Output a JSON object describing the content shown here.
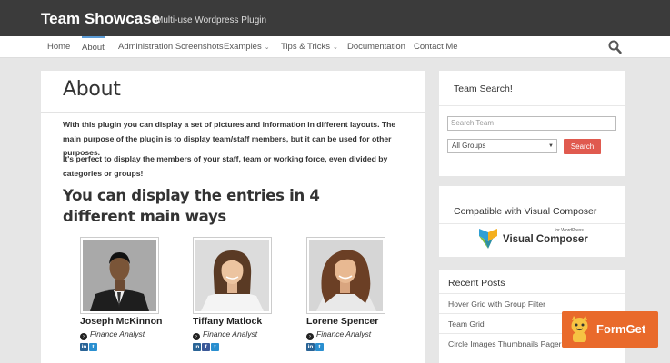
{
  "header": {
    "brand": "Team Showcase",
    "tagline": "Multi-use Wordpress Plugin"
  },
  "nav": {
    "items": [
      {
        "label": "Home"
      },
      {
        "label": "About",
        "active": true
      },
      {
        "label": "Administration Screenshots"
      },
      {
        "label": "Examples"
      },
      {
        "label": "Tips & Tricks"
      },
      {
        "label": "Documentation"
      },
      {
        "label": "Contact Me"
      }
    ],
    "caret": "⌄",
    "search_icon": "search-icon"
  },
  "main": {
    "title": "About",
    "paragraph1": "With this plugin you can display a set of pictures and information in different layouts. The main purpose of the plugin is to display team/staff members, but it can be used for other purposes.",
    "paragraph2": "It's perfect to display the members of your staff, team or working force, even divided by categories or groups!",
    "subheading": "You can display the entries in 4 different main ways",
    "members": [
      {
        "name": "Joseph McKinnon",
        "role": "Finance Analyst",
        "socials": [
          "in",
          "t"
        ]
      },
      {
        "name": "Tiffany Matlock",
        "role": "Finance Analyst",
        "socials": [
          "in",
          "f",
          "t"
        ]
      },
      {
        "name": "Lorene Spencer",
        "role": "Finance Analyst",
        "socials": [
          "in",
          "t"
        ]
      }
    ]
  },
  "sidebar": {
    "team_search": {
      "title": "Team Search!",
      "input_placeholder": "Search Team",
      "select_value": "All Groups",
      "button_label": "Search"
    },
    "visual_composer": {
      "title": "Compatible with Visual Composer",
      "logo_small": "for WordPress",
      "logo_text": "Visual Composer"
    },
    "recent_posts": {
      "title": "Recent Posts",
      "posts": [
        "Hover Grid with Group Filter",
        "Team Grid",
        "Circle Images Thumbnails Pager"
      ]
    }
  },
  "badge": {
    "text": "FormGet"
  },
  "colors": {
    "topbar": "#3b3b3b",
    "accent": "#5b9bd5",
    "button": "#e05a4f",
    "badge": "#e96a2b"
  }
}
